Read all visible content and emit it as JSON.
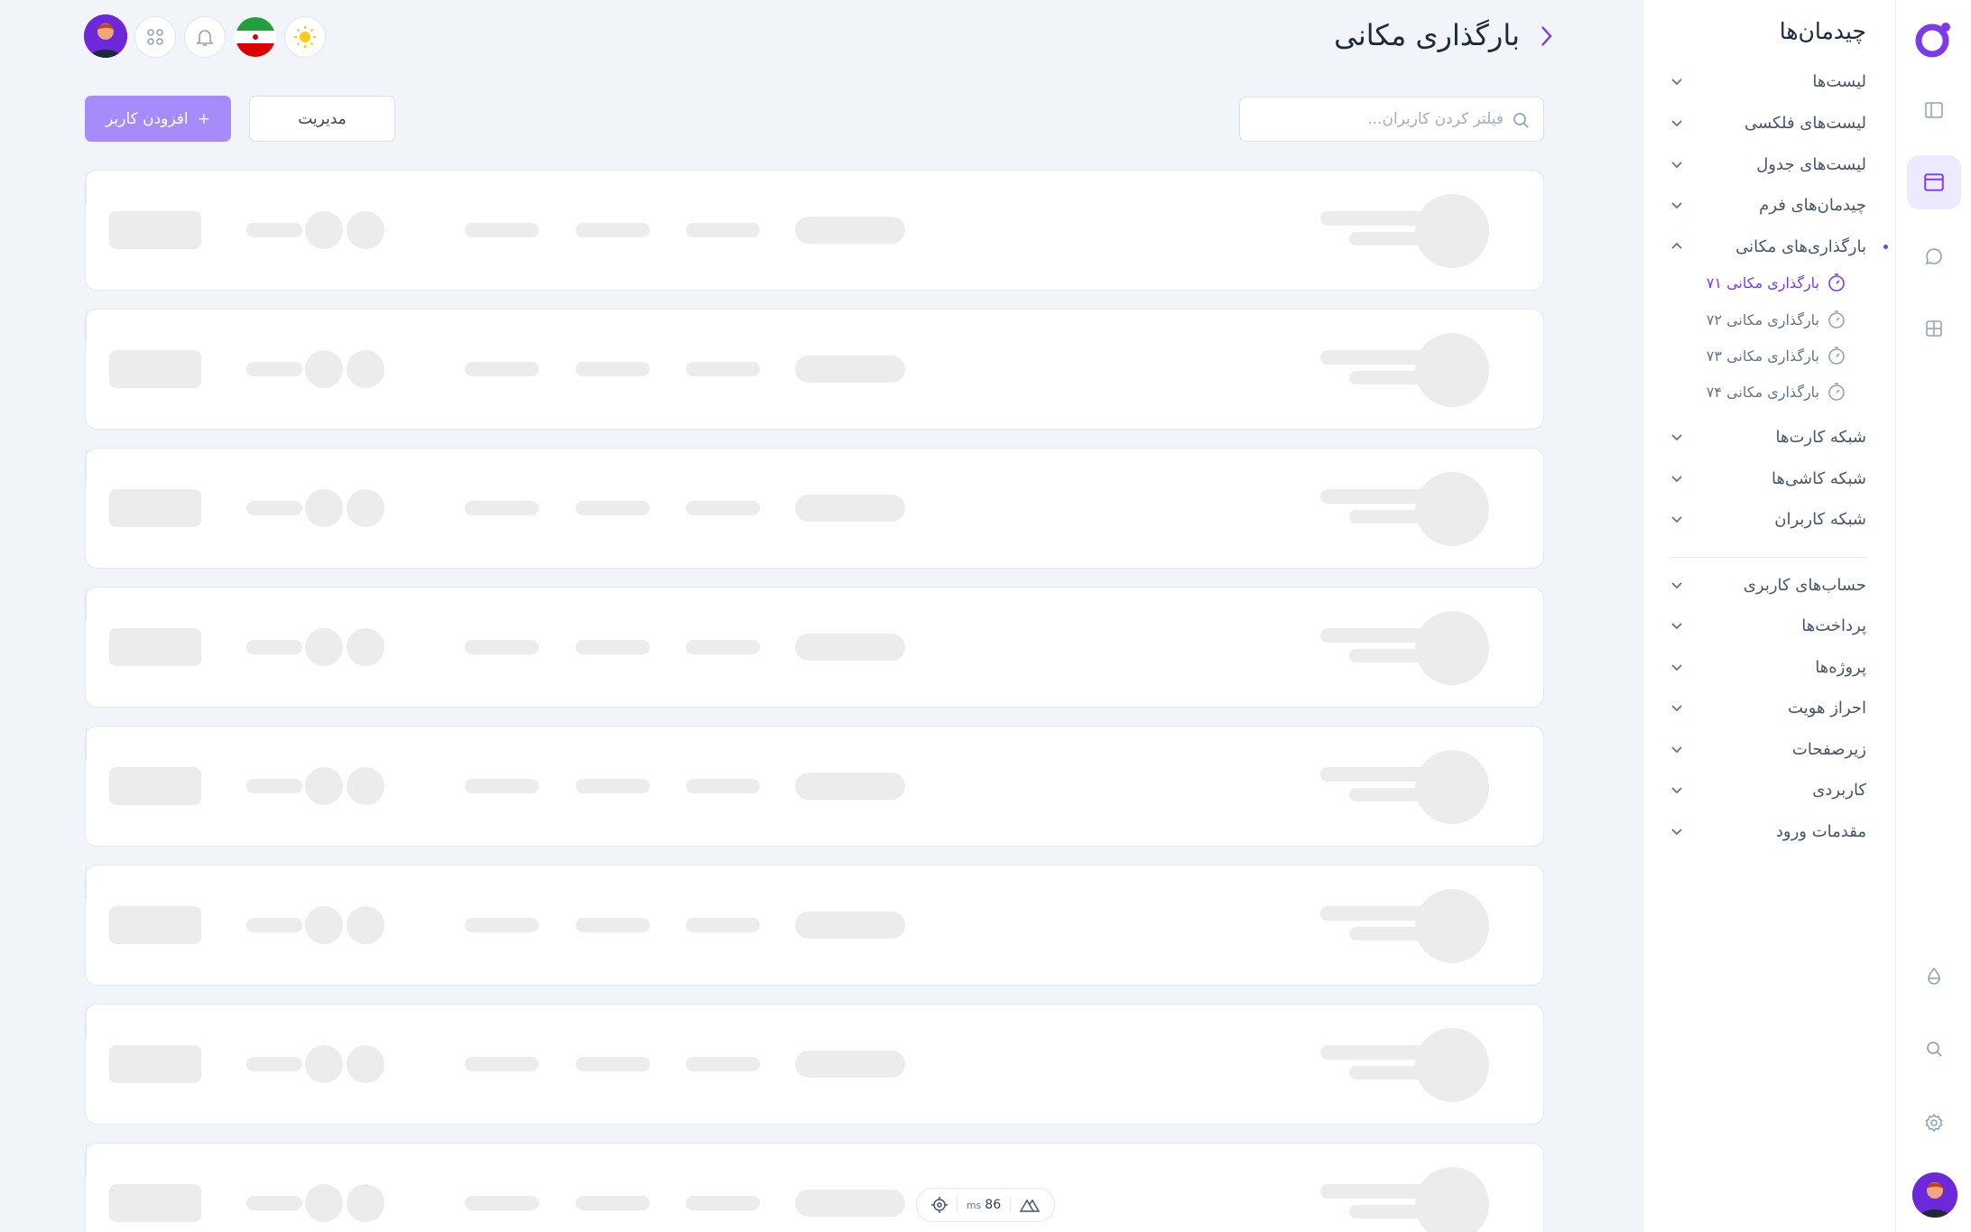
{
  "header": {
    "title": "بارگذاری مکانی",
    "back_icon": "chevron-right-icon",
    "icons": [
      "sun-icon",
      "iran-flag-icon",
      "bell-icon",
      "apps-grid-icon"
    ]
  },
  "toolbar": {
    "search_placeholder": "فیلتر کردن کاربران...",
    "manage_label": "مدیریت",
    "add_label": "افزودن کاربر",
    "add_icon": "plus-icon"
  },
  "subnav": {
    "title": "چیدمان‌ها",
    "groups": [
      {
        "label": "لیست‌ها"
      },
      {
        "label": "لیست‌های فلکسی"
      },
      {
        "label": "لیست‌های جدول"
      },
      {
        "label": "چیدمان‌های فرم"
      },
      {
        "label": "بارگذاری‌های مکانی",
        "expanded": true
      },
      {
        "label": "شبکه کارت‌ها"
      },
      {
        "label": "شبکه کاشی‌ها"
      },
      {
        "label": "شبکه کاربران"
      },
      {
        "label": "حساب‌های کاربری"
      },
      {
        "label": "پرداخت‌ها"
      },
      {
        "label": "پروژه‌ها"
      },
      {
        "label": "احراز هویت"
      },
      {
        "label": "زیرصفحات"
      },
      {
        "label": "کاربردی"
      },
      {
        "label": "مقدمات ورود"
      }
    ],
    "sub_items": [
      {
        "label": "بارگذاری مکانی ۷۱",
        "active": true
      },
      {
        "label": "بارگذاری مکانی ۷۲"
      },
      {
        "label": "بارگذاری مکانی ۷۳"
      },
      {
        "label": "بارگذاری مکانی ۷۴"
      }
    ]
  },
  "rail": {
    "icons": [
      "sidebar-toggle-icon",
      "layout-icon",
      "chat-icon",
      "grid-icon",
      "drop-icon",
      "search-icon",
      "settings-icon"
    ],
    "active": "layout-icon"
  },
  "perf": {
    "value": "86",
    "unit": "ms"
  },
  "colors": {
    "accent": "#7c3aed",
    "accent_light": "#a78bfa",
    "skeleton": "#ececec",
    "background": "#f1f5f9"
  }
}
